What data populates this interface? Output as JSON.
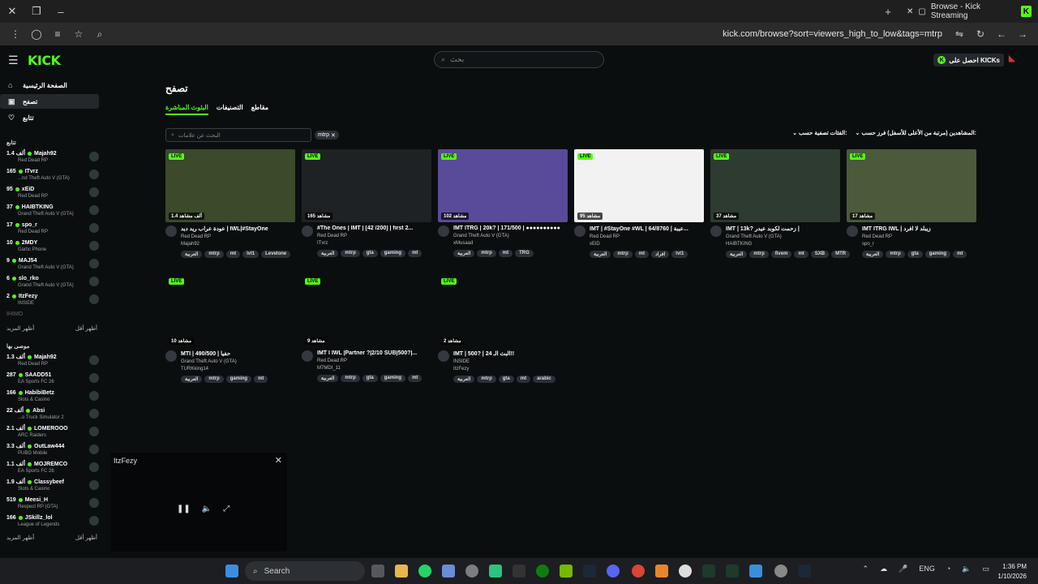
{
  "browser": {
    "tab_title": "Browse - Kick Streaming",
    "url": "kick.com/browse?sort=viewers_high_to_low&tags=mtrp"
  },
  "header": {
    "logo": "KICK",
    "search_placeholder": "بحث",
    "get_kicks": "احصل على KICKs"
  },
  "sidebar": {
    "nav": [
      {
        "label": "الصفحة الرئيسية",
        "icon": "home-icon"
      },
      {
        "label": "تصفح",
        "icon": "browse-icon"
      },
      {
        "label": "تتابع",
        "icon": "heart-icon"
      }
    ],
    "following_title": "تتابع",
    "following": [
      {
        "viewers": "1.4 ألف",
        "name": "Majah92",
        "category": "Red Dead RP"
      },
      {
        "viewers": "165",
        "name": "ITvrz",
        "category": "...nd Theft Auto V (GTA)"
      },
      {
        "viewers": "95",
        "name": "xEiD",
        "category": "Red Dead RP"
      },
      {
        "viewers": "37",
        "name": "HAIBTKING",
        "category": "Grand Theft Auto V (GTA)"
      },
      {
        "viewers": "17",
        "name": "spo_r",
        "category": "Red Dead RP"
      },
      {
        "viewers": "10",
        "name": "2MDY",
        "category": "Gartic Phone"
      },
      {
        "viewers": "9",
        "name": "MAJ54",
        "category": "Grand Theft Auto V (GTA)"
      },
      {
        "viewers": "6",
        "name": "slo_rko",
        "category": "Grand Theft Auto V (GTA)"
      },
      {
        "viewers": "2",
        "name": "ItzFezy",
        "category": "INSIDE"
      }
    ],
    "offline_name": "IHIMO",
    "show_more": "أظهر المزيد",
    "show_less": "أظهر أقل",
    "recommended_title": "موصى بها",
    "recommended": [
      {
        "viewers": "1.3 ألف",
        "name": "Majah92",
        "category": "Red Dead RP"
      },
      {
        "viewers": "287",
        "name": "SAADD51",
        "category": "EA Sports FC 26"
      },
      {
        "viewers": "166",
        "name": "HabibiBetz",
        "category": "Slots & Casino"
      },
      {
        "viewers": "22 ألف",
        "name": "Absi",
        "category": "...o Truck Simulator 2"
      },
      {
        "viewers": "2.1 ألف",
        "name": "LOMEROOO",
        "category": "ARC Raiders"
      },
      {
        "viewers": "3.3 ألف",
        "name": "OutLaw444",
        "category": "PUBG Mobile"
      },
      {
        "viewers": "1.1 ألف",
        "name": "MOJREMCO",
        "category": "EA Sports FC 26"
      },
      {
        "viewers": "1.9 ألف",
        "name": "Classybeef",
        "category": "Slots & Casino"
      },
      {
        "viewers": "519",
        "name": "Meesi_H",
        "category": "Respect RP (GTA)"
      },
      {
        "viewers": "166",
        "name": "JSkillz_lol",
        "category": "League of Legends"
      }
    ]
  },
  "main": {
    "title": "تصفح",
    "tabs": [
      "البثوث المباشرة",
      "التصنيفات",
      "مقاطع"
    ],
    "filter_placeholder": "البحث عن علامات",
    "active_tag": "mtrp",
    "sort_label": "فرز حسب:",
    "sort_value": "المشاهدين (مرتبة من الأعلى للأسفل)",
    "filter_by_label": "تصفية حسب:",
    "filter_by_value": "الفئات",
    "streams": [
      {
        "views": "1.4 ألف مشاهد",
        "title": "عودة عراب ريد ديد | IWL|#StayOne",
        "category": "Red Dead RP",
        "channel": "Majah92",
        "tags": [
          "العربية",
          "mtrp",
          "mt",
          "lvl1",
          "Levelone"
        ],
        "live": "LIVE",
        "thumb": "#3a4a2a"
      },
      {
        "views": "165 مشاهد",
        "title": "#The Ones | IMT | [42 /200] | first 2...",
        "category": "Red Dead RP",
        "channel": "ITvrz",
        "tags": [
          "العربية",
          "mtrp",
          "gta",
          "gaming",
          "mt"
        ],
        "live": "LIVE",
        "thumb": "#1e2224"
      },
      {
        "views": "102 مشاهد",
        "title": "IMT ITRG | 20k? | 171/500 | ●●●●●●●●●●",
        "category": "Grand Theft Auto V (GTA)",
        "channel": "xMusaad",
        "tags": [
          "العربية",
          "mtrp",
          "mt",
          "TRG"
        ],
        "live": "LIVE",
        "thumb": "#5a4a9a"
      },
      {
        "views": "95 مشاهد",
        "title": "IMT | #StayOne #WL | 64/8760 | عيبة...",
        "category": "Red Dead RP",
        "channel": "xEiD",
        "tags": [
          "العربية",
          "mtrp",
          "mt",
          "افراد",
          "lvl1"
        ],
        "live": "LIVE",
        "thumb": "#f2f2f2"
      },
      {
        "views": "37 مشاهد",
        "title": "IMT | 13k? زحمت لكوبد عيدر |",
        "category": "Grand Theft Auto V (GTA)",
        "channel": "HAIBTKING",
        "tags": [
          "العربية",
          "mtrp",
          "fivem",
          "mt",
          "SXB",
          "MTR"
        ],
        "live": "LIVE",
        "thumb": "#2d3b30"
      },
      {
        "views": "17 مشاهد",
        "title": "IMT ITRG IWL | زيبلد لا افرد",
        "category": "Red Dead RP",
        "channel": "spo_r",
        "tags": [
          "العربية",
          "mtrp",
          "gta",
          "gaming",
          "mt"
        ],
        "live": "LIVE",
        "thumb": "#4a5a3a"
      },
      {
        "views": "10 مشاهد",
        "title": "MTI | 490/500 | حفيا",
        "category": "Grand Theft Auto V (GTA)",
        "channel": "TURKking14",
        "tags": [
          "العربية",
          "mtrp",
          "gaming",
          "mt"
        ],
        "live": "LIVE",
        "thumb": "#0b0e0f"
      },
      {
        "views": "9 مشاهد",
        "title": "IMT I IWL |Partner ?|2/10 SUB|500?|...",
        "category": "Red Dead RP",
        "channel": "M7MDI_11",
        "tags": [
          "العربية",
          "mtrp",
          "gta",
          "gaming",
          "mt"
        ],
        "live": "LIVE",
        "thumb": "#0b0e0f"
      },
      {
        "views": "2 مشاهد",
        "title": "IMT | 500? | 24 البث الـ!!",
        "category": "INSIDE",
        "channel": "ItzFezy",
        "tags": [
          "العربية",
          "mtrp",
          "gta",
          "mt",
          "arabic"
        ],
        "live": "LIVE",
        "thumb": "#0b0e0f"
      }
    ]
  },
  "mini_player": {
    "channel": "ItzFezy"
  },
  "taskbar": {
    "search": "Search",
    "lang": "ENG",
    "time": "1:36 PM",
    "date": "1/10/2026"
  }
}
